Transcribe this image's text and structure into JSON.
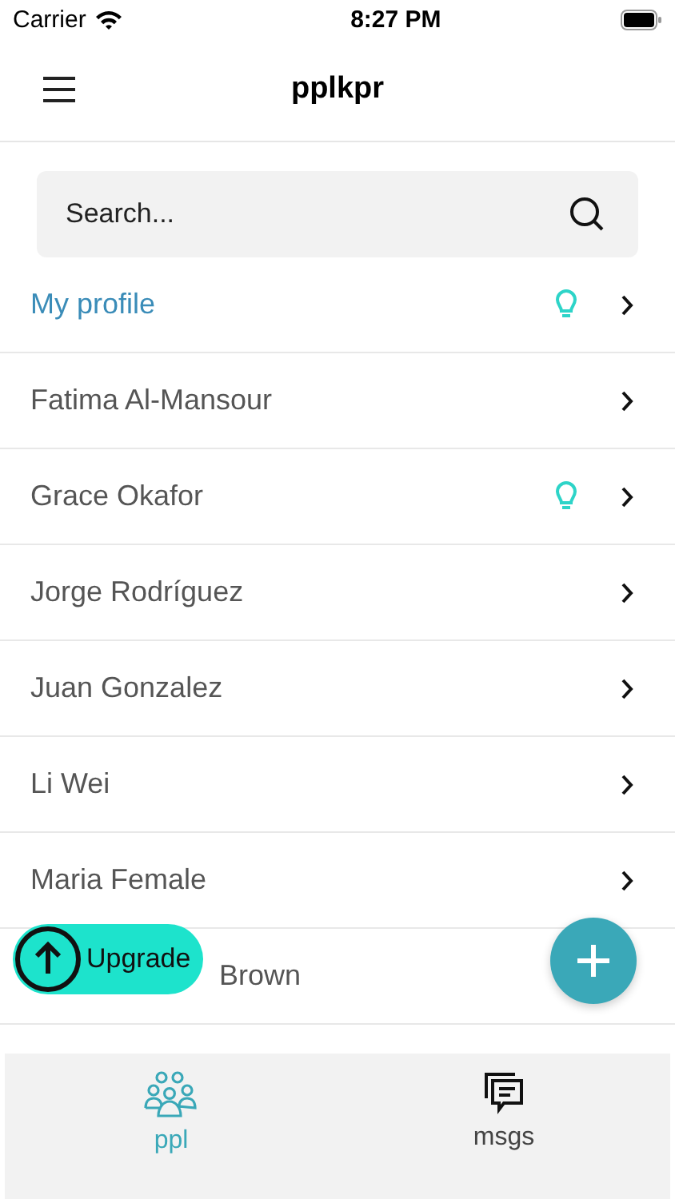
{
  "status_bar": {
    "carrier": "Carrier",
    "time": "8:27 PM"
  },
  "header": {
    "title": "pplkpr"
  },
  "search": {
    "placeholder": "Search..."
  },
  "rows": [
    {
      "name": "My profile",
      "highlight": true,
      "hint": true,
      "partial": false
    },
    {
      "name": "Fatima Al-Mansour",
      "highlight": false,
      "hint": false,
      "partial": false
    },
    {
      "name": "Grace Okafor",
      "highlight": false,
      "hint": true,
      "partial": false
    },
    {
      "name": "Jorge Rodríguez",
      "highlight": false,
      "hint": false,
      "partial": false
    },
    {
      "name": "Juan Gonzalez",
      "highlight": false,
      "hint": false,
      "partial": false
    },
    {
      "name": "Li Wei",
      "highlight": false,
      "hint": false,
      "partial": false
    },
    {
      "name": "Maria Female",
      "highlight": false,
      "hint": false,
      "partial": false
    },
    {
      "name": "Brown",
      "highlight": false,
      "hint": false,
      "partial": true
    }
  ],
  "upgrade": {
    "label": "Upgrade"
  },
  "tabs": [
    {
      "label": "ppl",
      "kind": "people",
      "selected": true
    },
    {
      "label": "msgs",
      "kind": "messages",
      "selected": false
    }
  ]
}
